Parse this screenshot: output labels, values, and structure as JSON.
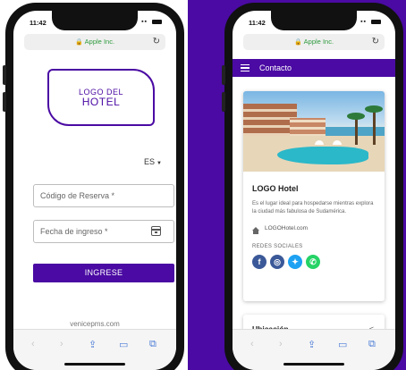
{
  "left_phone": {
    "status_time": "11:42",
    "url": "Apple Inc.",
    "logo_line1": "LOGO DEL",
    "logo_line2": "HOTEL",
    "language": "ES",
    "reservation_placeholder": "Código de Reserva *",
    "checkin_placeholder": "Fecha de ingreso *",
    "submit_label": "INGRESE",
    "footer_link": "venicepms.com"
  },
  "right_phone": {
    "status_time": "11:42",
    "url": "Apple Inc.",
    "app_bar_title": "Contacto",
    "hotel_name": "LOGO Hotel",
    "hotel_description": "Es el lugar ideal para hospedarse mientras explora la ciudad más fabulosa de Sudamérica.",
    "website": "LOGOHotel.com",
    "social_title": "REDES SOCIALES",
    "social_networks": [
      "facebook",
      "instagram",
      "twitter",
      "whatsapp"
    ],
    "location_title": "Ubicación"
  },
  "colors": {
    "brand_purple": "#4a0aa3",
    "url_green": "#2e9b3e",
    "facebook": "#3b5998",
    "twitter": "#1da1f2",
    "whatsapp": "#25d366"
  },
  "icons": {
    "lock": "lock-icon",
    "reload": "reload-icon",
    "calendar": "calendar-icon",
    "menu": "hamburger-menu-icon",
    "home": "home-icon",
    "share": "share-icon"
  }
}
